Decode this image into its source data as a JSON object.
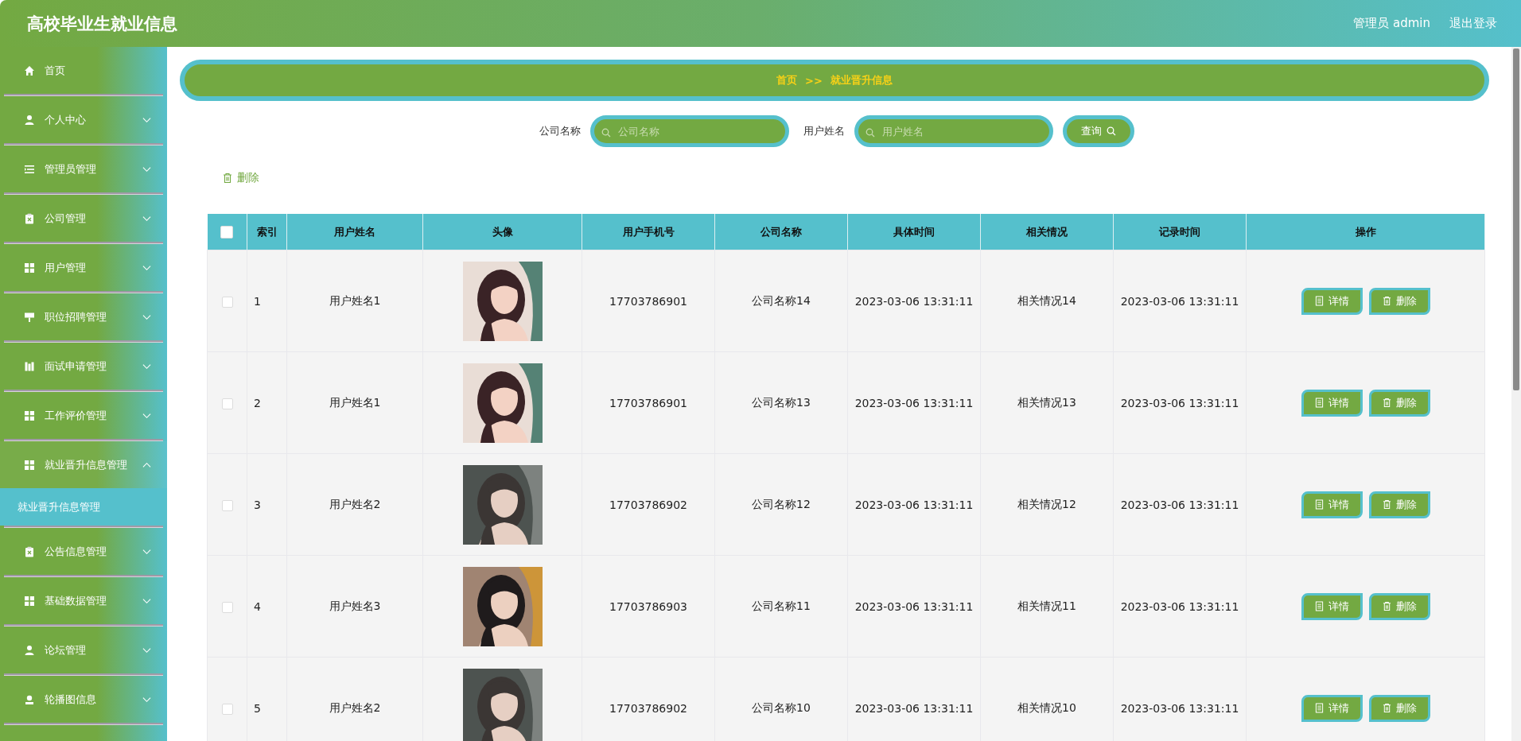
{
  "header": {
    "title": "高校毕业生就业信息",
    "user": "管理员 admin",
    "logout": "退出登录"
  },
  "sidebar": {
    "items": [
      {
        "label": "首页",
        "expandable": false
      },
      {
        "label": "个人中心",
        "expandable": true,
        "expanded": false
      },
      {
        "label": "管理员管理",
        "expandable": true,
        "expanded": false
      },
      {
        "label": "公司管理",
        "expandable": true,
        "expanded": false
      },
      {
        "label": "用户管理",
        "expandable": true,
        "expanded": false
      },
      {
        "label": "职位招聘管理",
        "expandable": true,
        "expanded": false
      },
      {
        "label": "面试申请管理",
        "expandable": true,
        "expanded": false
      },
      {
        "label": "工作评价管理",
        "expandable": true,
        "expanded": false
      },
      {
        "label": "就业晋升信息管理",
        "expandable": true,
        "expanded": true,
        "children": [
          {
            "label": "就业晋升信息管理",
            "selected": true
          }
        ]
      },
      {
        "label": "公告信息管理",
        "expandable": true,
        "expanded": false
      },
      {
        "label": "基础数据管理",
        "expandable": true,
        "expanded": false
      },
      {
        "label": "论坛管理",
        "expandable": true,
        "expanded": false
      },
      {
        "label": "轮播图信息",
        "expandable": true,
        "expanded": false
      }
    ]
  },
  "breadcrumb": [
    "首页",
    ">>",
    "就业晋升信息"
  ],
  "search": {
    "fields": [
      {
        "label": "公司名称",
        "placeholder": "公司名称"
      },
      {
        "label": "用户姓名",
        "placeholder": "用户姓名"
      }
    ],
    "button": "查询"
  },
  "toolbar": {
    "delete": "删除"
  },
  "table": {
    "all_checked": false,
    "columns": [
      "索引",
      "用户姓名",
      "头像",
      "用户手机号",
      "公司名称",
      "具体时间",
      "相关情况",
      "记录时间",
      "操作"
    ],
    "rows": [
      {
        "checked": false,
        "index": "1",
        "name": "用户姓名1",
        "phone": "17703786901",
        "company": "公司名称14",
        "time": "2023-03-06 13:31:11",
        "situation": "相关情况14",
        "record_time": "2023-03-06 13:31:11",
        "actions": [
          "详情",
          "删除"
        ]
      },
      {
        "checked": false,
        "index": "2",
        "name": "用户姓名1",
        "phone": "17703786901",
        "company": "公司名称13",
        "time": "2023-03-06 13:31:11",
        "situation": "相关情况13",
        "record_time": "2023-03-06 13:31:11",
        "actions": [
          "详情",
          "删除"
        ]
      },
      {
        "checked": false,
        "index": "3",
        "name": "用户姓名2",
        "phone": "17703786902",
        "company": "公司名称12",
        "time": "2023-03-06 13:31:11",
        "situation": "相关情况12",
        "record_time": "2023-03-06 13:31:11",
        "actions": [
          "详情",
          "删除"
        ]
      },
      {
        "checked": false,
        "index": "4",
        "name": "用户姓名3",
        "phone": "17703786903",
        "company": "公司名称11",
        "time": "2023-03-06 13:31:11",
        "situation": "相关情况11",
        "record_time": "2023-03-06 13:31:11",
        "actions": [
          "详情",
          "删除"
        ]
      },
      {
        "checked": false,
        "index": "5",
        "name": "用户姓名2",
        "phone": "17703786902",
        "company": "公司名称10",
        "time": "2023-03-06 13:31:11",
        "situation": "相关情况10",
        "record_time": "2023-03-06 13:31:11",
        "actions": [
          "详情",
          "删除"
        ]
      }
    ]
  }
}
